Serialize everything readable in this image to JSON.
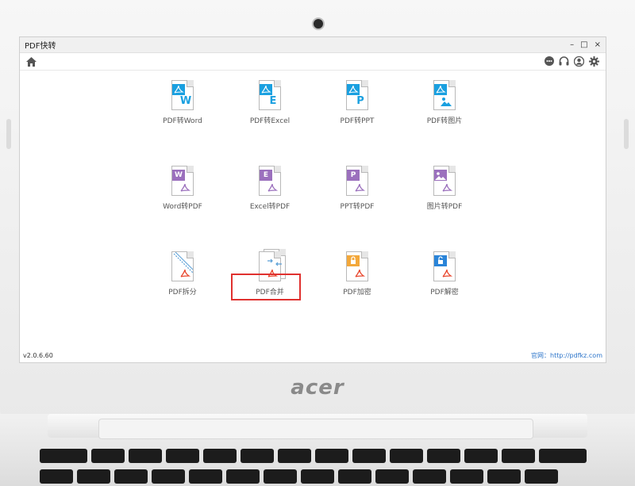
{
  "window": {
    "title": "PDF快转",
    "controls": [
      "–",
      "□",
      "×"
    ]
  },
  "toolbar": {
    "home_icon": "home-icon",
    "right_icons": [
      "chat-icon",
      "headset-icon",
      "user-icon",
      "gear-icon"
    ]
  },
  "tools": [
    {
      "label": "PDF转Word",
      "tag": "",
      "letter": "W",
      "color": "#1aa0e0",
      "style": "pdf-to"
    },
    {
      "label": "PDF转Excel",
      "tag": "",
      "letter": "E",
      "color": "#1aa0e0",
      "style": "pdf-to"
    },
    {
      "label": "PDF转PPT",
      "tag": "",
      "letter": "P",
      "color": "#1aa0e0",
      "style": "pdf-to"
    },
    {
      "label": "PDF转图片",
      "tag": "",
      "letter": "",
      "color": "#1aa0e0",
      "style": "pdf-to-image"
    },
    {
      "label": "Word转PDF",
      "tag": "W",
      "letter": "",
      "color": "#9b70bd",
      "style": "to-pdf"
    },
    {
      "label": "Excel转PDF",
      "tag": "E",
      "letter": "",
      "color": "#9b70bd",
      "style": "to-pdf"
    },
    {
      "label": "PPT转PDF",
      "tag": "P",
      "letter": "",
      "color": "#9b70bd",
      "style": "to-pdf"
    },
    {
      "label": "图片转PDF",
      "tag": "",
      "letter": "",
      "color": "#9b70bd",
      "style": "image-to-pdf"
    },
    {
      "label": "PDF拆分",
      "tag": "",
      "letter": "",
      "color": "#5a9fd6",
      "style": "split"
    },
    {
      "label": "PDF合并",
      "tag": "",
      "letter": "",
      "color": "#5a9fd6",
      "style": "merge"
    },
    {
      "label": "PDF加密",
      "tag": "",
      "letter": "",
      "color": "#f3a83b",
      "style": "encrypt"
    },
    {
      "label": "PDF解密",
      "tag": "",
      "letter": "",
      "color": "#2a84d8",
      "style": "decrypt"
    }
  ],
  "selected_tool": "PDF合并",
  "status": {
    "version": "v2.0.6.60",
    "website": "官网：http://pdfkz.com"
  },
  "hardware": {
    "brand_logo": "acer"
  },
  "colors": {
    "accent_blue": "#1aa0e0",
    "accent_purple": "#9b70bd",
    "selection_red": "#e0312f",
    "pdf_red": "#e8452c"
  }
}
